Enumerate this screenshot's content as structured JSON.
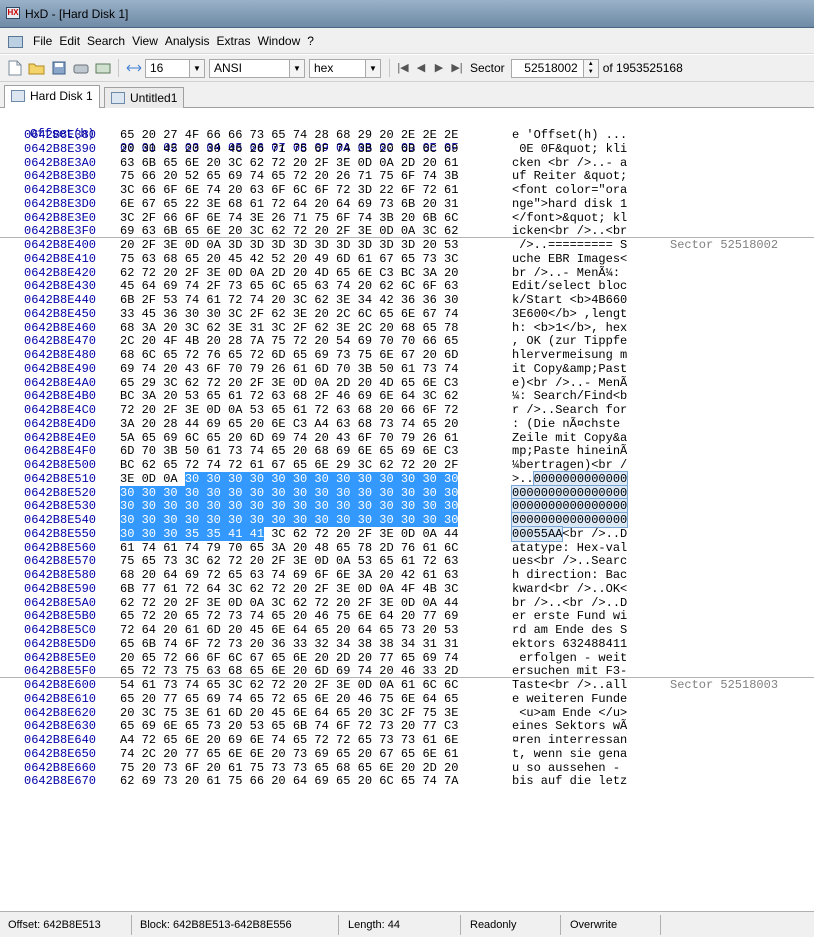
{
  "window": {
    "title": "HxD - [Hard Disk 1]"
  },
  "menu": [
    "File",
    "Edit",
    "Search",
    "View",
    "Analysis",
    "Extras",
    "Window",
    "?"
  ],
  "toolbar": {
    "bytes_per_row": "16",
    "charset": "ANSI",
    "offset_base": "hex",
    "sector_label": "Sector",
    "sector_value": "52518002",
    "sector_total": "of 1953525168"
  },
  "tabs": [
    {
      "label": "Hard Disk 1",
      "active": true
    },
    {
      "label": "Untitled1",
      "active": false
    }
  ],
  "hex_header": {
    "offset_label": "Offset(h)",
    "columns": "00 01 02 03 04 05 06 07 08 09 0A 0B 0C 0D 0E 0F"
  },
  "rows": [
    {
      "offset": "0642B8E380",
      "hex": "65 20 27 4F 66 66 73 65 74 28 68 29 20 2E 2E 2E",
      "ascii": "e 'Offset(h) ..."
    },
    {
      "offset": "0642B8E390",
      "hex": "20 30 45 20 30 46 26 71 75 6F 74 3B 20 6B 6C 69",
      "ascii": " 0E 0F&quot; kli"
    },
    {
      "offset": "0642B8E3A0",
      "hex": "63 6B 65 6E 20 3C 62 72 20 2F 3E 0D 0A 2D 20 61",
      "ascii": "cken <br />..- a"
    },
    {
      "offset": "0642B8E3B0",
      "hex": "75 66 20 52 65 69 74 65 72 20 26 71 75 6F 74 3B",
      "ascii": "uf Reiter &quot;"
    },
    {
      "offset": "0642B8E3C0",
      "hex": "3C 66 6F 6E 74 20 63 6F 6C 6F 72 3D 22 6F 72 61",
      "ascii": "<font color=\"ora"
    },
    {
      "offset": "0642B8E3D0",
      "hex": "6E 67 65 22 3E 68 61 72 64 20 64 69 73 6B 20 31",
      "ascii": "nge\">hard disk 1"
    },
    {
      "offset": "0642B8E3E0",
      "hex": "3C 2F 66 6F 6E 74 3E 26 71 75 6F 74 3B 20 6B 6C",
      "ascii": "</font>&quot; kl"
    },
    {
      "offset": "0642B8E3F0",
      "hex": "69 63 6B 65 6E 20 3C 62 72 20 2F 3E 0D 0A 3C 62",
      "ascii": "icken<br />..<br"
    },
    {
      "offset": "0642B8E400",
      "hex": "20 2F 3E 0D 0A 3D 3D 3D 3D 3D 3D 3D 3D 3D 20 53",
      "ascii": " />..========= S",
      "sector": "Sector 52518002"
    },
    {
      "offset": "0642B8E410",
      "hex": "75 63 68 65 20 45 42 52 20 49 6D 61 67 65 73 3C",
      "ascii": "uche EBR Images<"
    },
    {
      "offset": "0642B8E420",
      "hex": "62 72 20 2F 3E 0D 0A 2D 20 4D 65 6E C3 BC 3A 20",
      "ascii": "br />..- MenÃ¼: "
    },
    {
      "offset": "0642B8E430",
      "hex": "45 64 69 74 2F 73 65 6C 65 63 74 20 62 6C 6F 63",
      "ascii": "Edit/select bloc"
    },
    {
      "offset": "0642B8E440",
      "hex": "6B 2F 53 74 61 72 74 20 3C 62 3E 34 42 36 36 30",
      "ascii": "k/Start <b>4B660"
    },
    {
      "offset": "0642B8E450",
      "hex": "33 45 36 30 30 3C 2F 62 3E 20 2C 6C 65 6E 67 74",
      "ascii": "3E600</b> ,lengt"
    },
    {
      "offset": "0642B8E460",
      "hex": "68 3A 20 3C 62 3E 31 3C 2F 62 3E 2C 20 68 65 78",
      "ascii": "h: <b>1</b>, hex"
    },
    {
      "offset": "0642B8E470",
      "hex": "2C 20 4F 4B 20 28 7A 75 72 20 54 69 70 70 66 65",
      "ascii": ", OK (zur Tippfe"
    },
    {
      "offset": "0642B8E480",
      "hex": "68 6C 65 72 76 65 72 6D 65 69 73 75 6E 67 20 6D",
      "ascii": "hlervermeisung m"
    },
    {
      "offset": "0642B8E490",
      "hex": "69 74 20 43 6F 70 79 26 61 6D 70 3B 50 61 73 74",
      "ascii": "it Copy&amp;Past"
    },
    {
      "offset": "0642B8E4A0",
      "hex": "65 29 3C 62 72 20 2F 3E 0D 0A 2D 20 4D 65 6E C3",
      "ascii": "e)<br />..- MenÃ"
    },
    {
      "offset": "0642B8E4B0",
      "hex": "BC 3A 20 53 65 61 72 63 68 2F 46 69 6E 64 3C 62",
      "ascii": "¼: Search/Find<b"
    },
    {
      "offset": "0642B8E4C0",
      "hex": "72 20 2F 3E 0D 0A 53 65 61 72 63 68 20 66 6F 72",
      "ascii": "r />..Search for"
    },
    {
      "offset": "0642B8E4D0",
      "hex": "3A 20 28 44 69 65 20 6E C3 A4 63 68 73 74 65 20",
      "ascii": ": (Die nÃ¤chste "
    },
    {
      "offset": "0642B8E4E0",
      "hex": "5A 65 69 6C 65 20 6D 69 74 20 43 6F 70 79 26 61",
      "ascii": "Zeile mit Copy&a"
    },
    {
      "offset": "0642B8E4F0",
      "hex": "6D 70 3B 50 61 73 74 65 20 68 69 6E 65 69 6E C3",
      "ascii": "mp;Paste hineinÃ"
    },
    {
      "offset": "0642B8E500",
      "hex": "BC 62 65 72 74 72 61 67 65 6E 29 3C 62 72 20 2F",
      "ascii": "¼bertragen)<br /"
    },
    {
      "offset": "0642B8E510",
      "hex_pre": "3E 0D 0A ",
      "hex_sel": "30 30 30 30 30 30 30 30 30 30 30 30 30",
      "ascii_pre": ">..",
      "ascii_sel": "0000000000000"
    },
    {
      "offset": "0642B8E520",
      "hex_sel": "30 30 30 30 30 30 30 30 30 30 30 30 30 30 30 30",
      "ascii_sel": "0000000000000000"
    },
    {
      "offset": "0642B8E530",
      "hex_sel": "30 30 30 30 30 30 30 30 30 30 30 30 30 30 30 30",
      "ascii_sel": "0000000000000000"
    },
    {
      "offset": "0642B8E540",
      "hex_sel": "30 30 30 30 30 30 30 30 30 30 30 30 30 30 30 30",
      "ascii_sel": "0000000000000000"
    },
    {
      "offset": "0642B8E550",
      "hex_sel": "30 30 30 35 35 41 41",
      "hex_post": " 3C 62 72 20 2F 3E 0D 0A 44",
      "ascii_sel": "00055AA",
      "ascii_post": "<br />..D"
    },
    {
      "offset": "0642B8E560",
      "hex": "61 74 61 74 79 70 65 3A 20 48 65 78 2D 76 61 6C",
      "ascii": "atatype: Hex-val"
    },
    {
      "offset": "0642B8E570",
      "hex": "75 65 73 3C 62 72 20 2F 3E 0D 0A 53 65 61 72 63",
      "ascii": "ues<br />..Searc"
    },
    {
      "offset": "0642B8E580",
      "hex": "68 20 64 69 72 65 63 74 69 6F 6E 3A 20 42 61 63",
      "ascii": "h direction: Bac"
    },
    {
      "offset": "0642B8E590",
      "hex": "6B 77 61 72 64 3C 62 72 20 2F 3E 0D 0A 4F 4B 3C",
      "ascii": "kward<br />..OK<"
    },
    {
      "offset": "0642B8E5A0",
      "hex": "62 72 20 2F 3E 0D 0A 3C 62 72 20 2F 3E 0D 0A 44",
      "ascii": "br />..<br />..D"
    },
    {
      "offset": "0642B8E5B0",
      "hex": "65 72 20 65 72 73 74 65 20 46 75 6E 64 20 77 69",
      "ascii": "er erste Fund wi"
    },
    {
      "offset": "0642B8E5C0",
      "hex": "72 64 20 61 6D 20 45 6E 64 65 20 64 65 73 20 53",
      "ascii": "rd am Ende des S"
    },
    {
      "offset": "0642B8E5D0",
      "hex": "65 6B 74 6F 72 73 20 36 33 32 34 38 38 34 31 31",
      "ascii": "ektors 632488411"
    },
    {
      "offset": "0642B8E5E0",
      "hex": "20 65 72 66 6F 6C 67 65 6E 20 2D 20 77 65 69 74",
      "ascii": " erfolgen - weit"
    },
    {
      "offset": "0642B8E5F0",
      "hex": "65 72 73 75 63 68 65 6E 20 6D 69 74 20 46 33 2D",
      "ascii": "ersuchen mit F3-"
    },
    {
      "offset": "0642B8E600",
      "hex": "54 61 73 74 65 3C 62 72 20 2F 3E 0D 0A 61 6C 6C",
      "ascii": "Taste<br />..all",
      "sector": "Sector 52518003"
    },
    {
      "offset": "0642B8E610",
      "hex": "65 20 77 65 69 74 65 72 65 6E 20 46 75 6E 64 65",
      "ascii": "e weiteren Funde"
    },
    {
      "offset": "0642B8E620",
      "hex": "20 3C 75 3E 61 6D 20 45 6E 64 65 20 3C 2F 75 3E",
      "ascii": " <u>am Ende </u>"
    },
    {
      "offset": "0642B8E630",
      "hex": "65 69 6E 65 73 20 53 65 6B 74 6F 72 73 20 77 C3",
      "ascii": "eines Sektors wÃ"
    },
    {
      "offset": "0642B8E640",
      "hex": "A4 72 65 6E 20 69 6E 74 65 72 72 65 73 73 61 6E",
      "ascii": "¤ren interressan"
    },
    {
      "offset": "0642B8E650",
      "hex": "74 2C 20 77 65 6E 6E 20 73 69 65 20 67 65 6E 61",
      "ascii": "t, wenn sie gena"
    },
    {
      "offset": "0642B8E660",
      "hex": "75 20 73 6F 20 61 75 73 73 65 68 65 6E 20 2D 20",
      "ascii": "u so aussehen - "
    },
    {
      "offset": "0642B8E670",
      "hex": "62 69 73 20 61 75 66 20 64 69 65 20 6C 65 74 7A",
      "ascii": "bis auf die letz"
    }
  ],
  "status": {
    "offset": "Offset: 642B8E513",
    "block": "Block: 642B8E513-642B8E556",
    "length": "Length: 44",
    "mode": "Readonly",
    "insert": "Overwrite"
  }
}
